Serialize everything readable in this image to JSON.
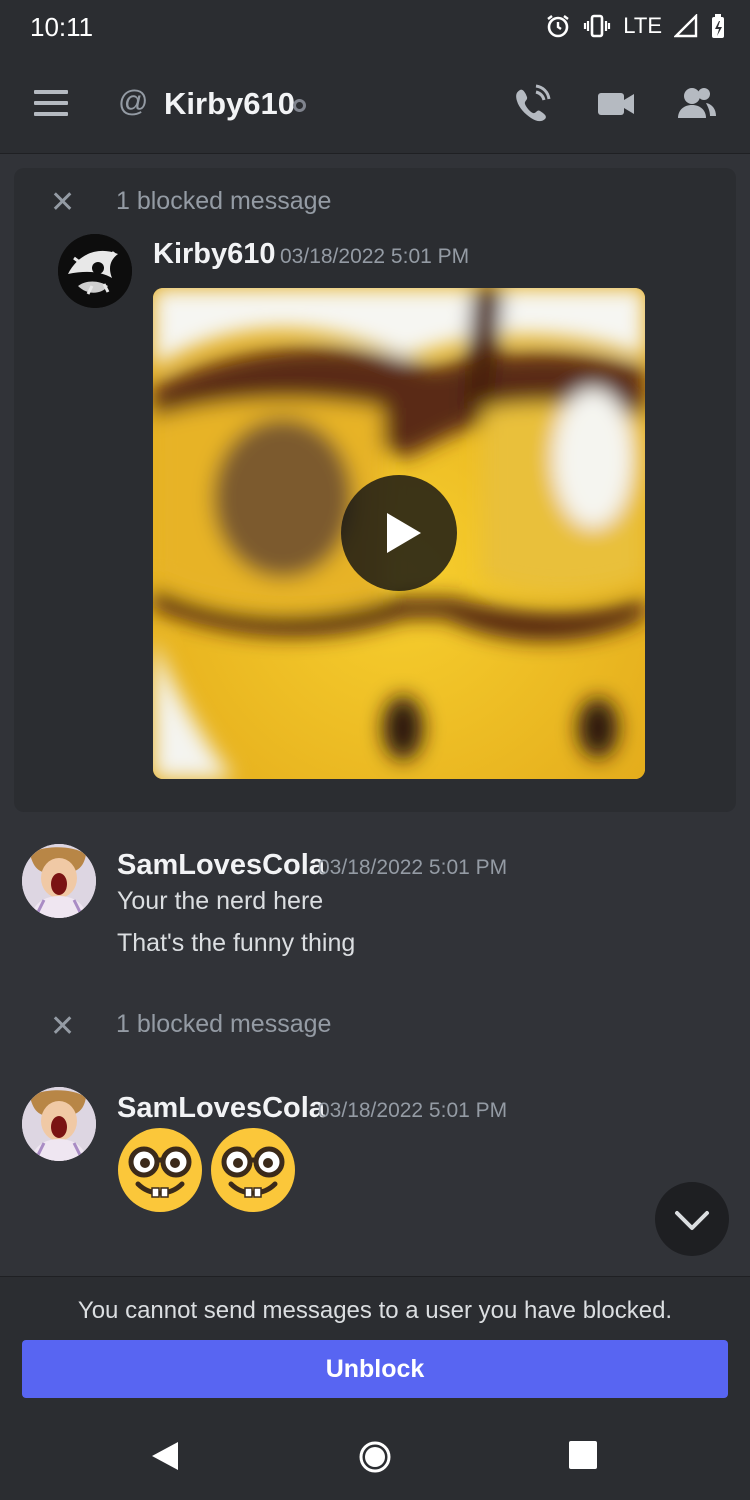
{
  "status_bar": {
    "time": "10:11",
    "network": "LTE",
    "icons": [
      "alarm-icon",
      "vibrate-icon",
      "signal-icon",
      "battery-icon"
    ]
  },
  "header": {
    "channel_name": "Kirby610",
    "at_symbol": "@",
    "icons": [
      "menu-icon",
      "voice-call-icon",
      "video-call-icon",
      "members-icon"
    ]
  },
  "messages": {
    "blocked_1": {
      "label": "1 blocked message",
      "username": "Kirby610",
      "timestamp": "03/18/2022 5:01 PM"
    },
    "group_1": {
      "username": "SamLovesCola",
      "timestamp": "03/18/2022 5:01 PM",
      "lines": [
        "Your the nerd here",
        "That's the funny thing"
      ]
    },
    "blocked_2": {
      "label": "1 blocked message"
    },
    "group_2": {
      "username": "SamLovesCola",
      "timestamp": "03/18/2022 5:01 PM",
      "emojis": [
        "nerd-face-emoji",
        "nerd-face-emoji"
      ]
    }
  },
  "footer": {
    "notice": "You cannot send messages to a user you have blocked.",
    "unblock_label": "Unblock"
  },
  "colors": {
    "background": "#313338",
    "surface": "#2b2d31",
    "accent": "#5865f2",
    "muted_text": "#949ba4"
  }
}
